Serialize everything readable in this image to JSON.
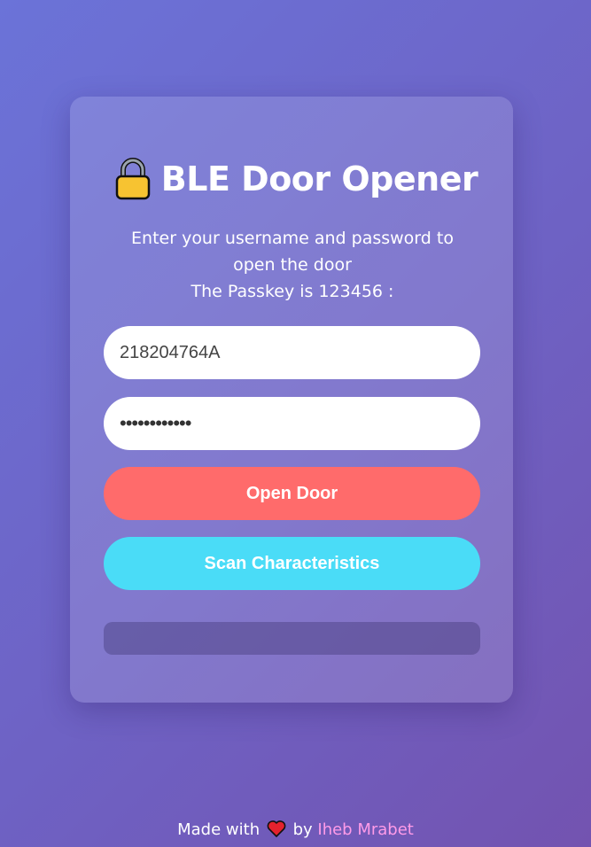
{
  "app": {
    "title": "BLE Door Opener",
    "title_icon": "lock-icon"
  },
  "instructions": {
    "line1": "Enter your username and password to",
    "line2": "open the door",
    "line3": "The Passkey is 123456 :"
  },
  "form": {
    "username_value": "218204764A",
    "password_masked": "••••••••••••",
    "open_button_label": "Open Door",
    "scan_button_label": "Scan Characteristics"
  },
  "status": {
    "message": ""
  },
  "footer": {
    "made_with": "Made with",
    "by": "by",
    "author": "Iheb Mrabet",
    "heart_icon": "heart-icon"
  },
  "colors": {
    "open_button": "#ff6b6b",
    "scan_button": "#4adcf7",
    "author_link": "#ff9be8"
  }
}
